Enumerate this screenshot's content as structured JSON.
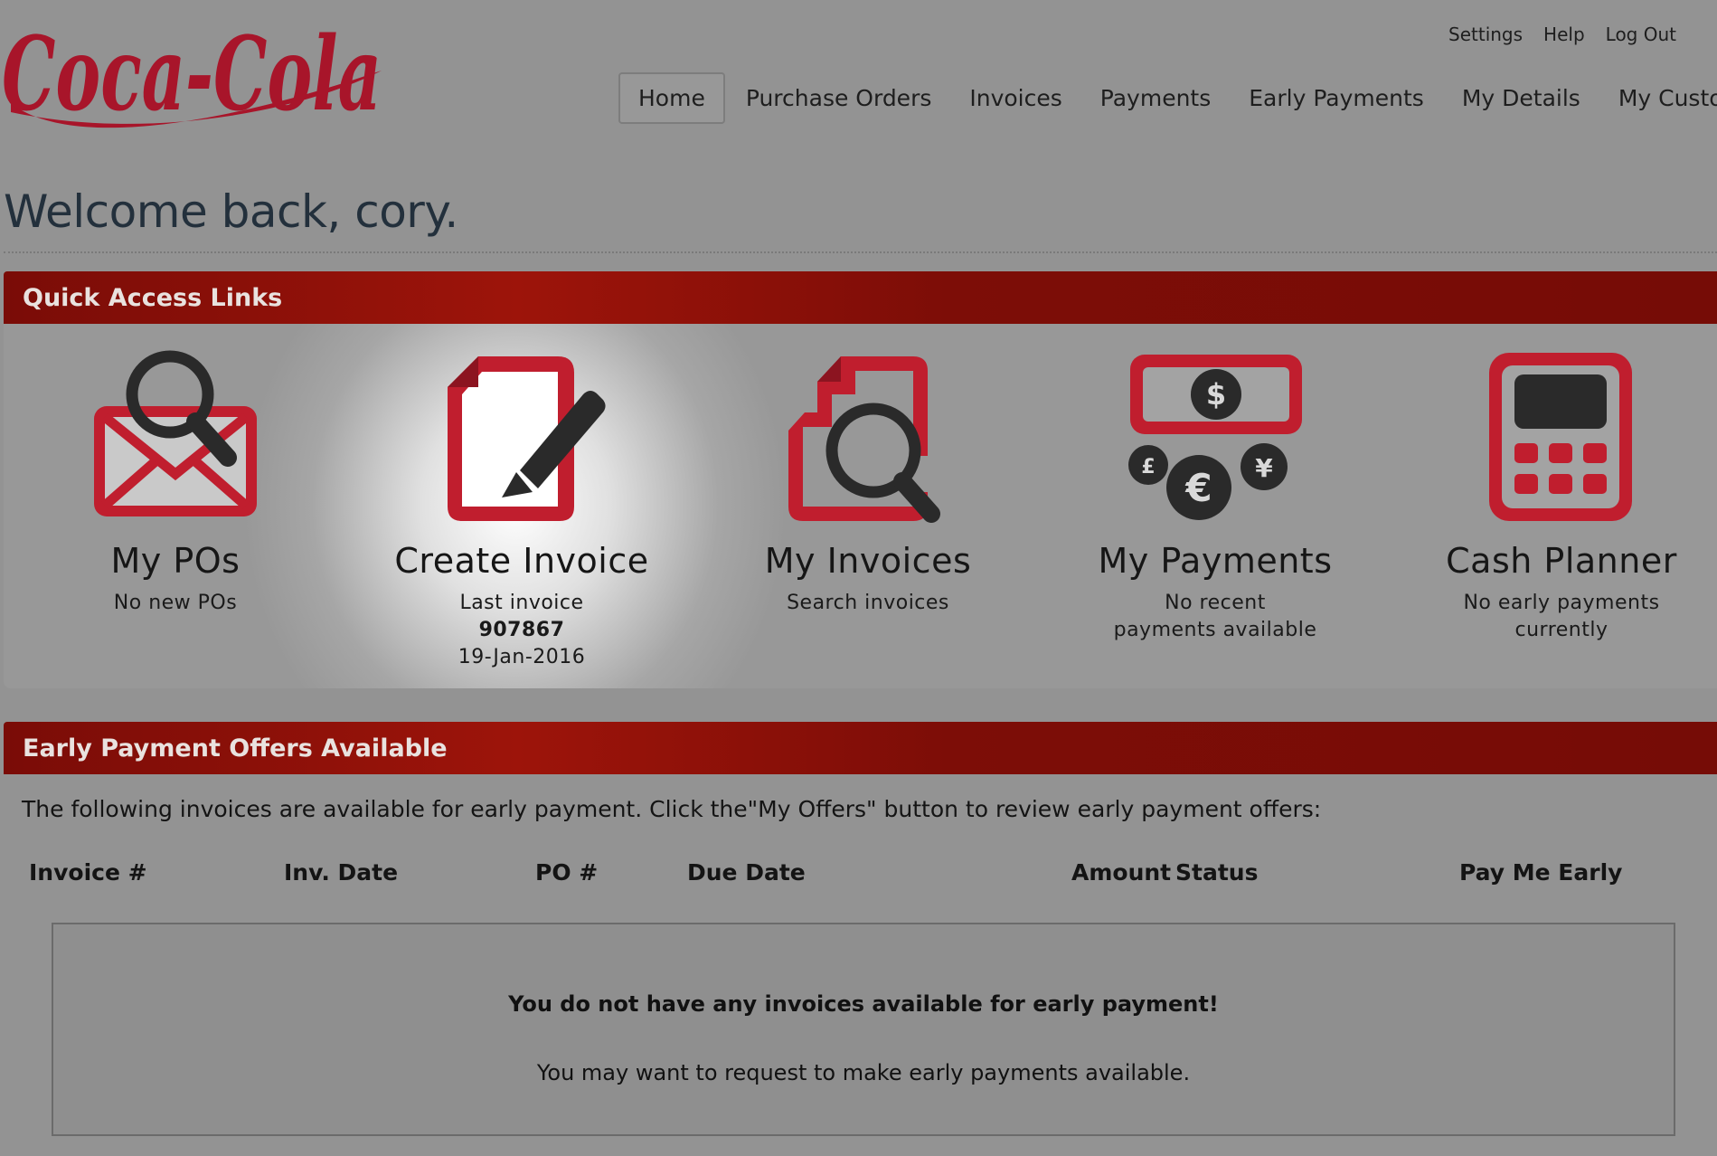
{
  "brand": {
    "logo_text": "Coca-Cola",
    "color": "#a8152a"
  },
  "utility_links": [
    "Settings",
    "Help",
    "Log Out"
  ],
  "nav": {
    "items": [
      "Home",
      "Purchase Orders",
      "Invoices",
      "Payments",
      "Early Payments",
      "My Details",
      "My Customer"
    ],
    "active": "Home"
  },
  "welcome": "Welcome back, cory.",
  "quick_access": {
    "title": "Quick Access Links",
    "items": [
      {
        "title": "My POs",
        "lines": [
          "No new POs"
        ],
        "icon": "envelope-search-icon"
      },
      {
        "title": "Create Invoice",
        "lines": [
          "Last invoice",
          "907867",
          "19-Jan-2016"
        ],
        "icon": "document-pencil-icon"
      },
      {
        "title": "My Invoices",
        "lines": [
          "Search invoices"
        ],
        "icon": "documents-search-icon"
      },
      {
        "title": "My Payments",
        "lines": [
          "No recent",
          "payments available"
        ],
        "icon": "currency-icon"
      },
      {
        "title": "Cash Planner",
        "lines": [
          "No early payments",
          "currently"
        ],
        "icon": "calculator-icon"
      }
    ]
  },
  "early_payment": {
    "title": "Early Payment Offers Available",
    "intro": "The following invoices are available for early payment. Click the\"My Offers\" button to review early payment offers:",
    "columns": [
      "Invoice #",
      "Inv. Date",
      "PO #",
      "Due Date",
      "Amount",
      "Status",
      "Pay Me Early"
    ],
    "empty_title": "You do not have any invoices available for early payment!",
    "empty_sub": "You may want to request to make early payments available."
  },
  "colors": {
    "header_red": "#8a0f08",
    "icon_red": "#c01e2e",
    "icon_dark": "#2a2a2a",
    "background": "#939393"
  }
}
